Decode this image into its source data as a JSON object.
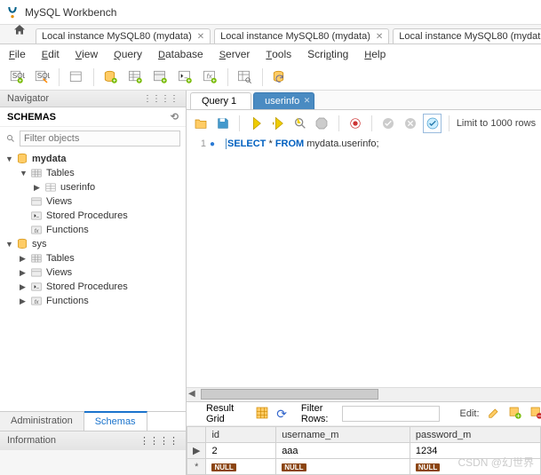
{
  "window": {
    "title": "MySQL Workbench"
  },
  "doc_tabs": [
    {
      "label": "Local instance MySQL80 (mydata)"
    },
    {
      "label": "Local instance MySQL80 (mydata)"
    },
    {
      "label": "Local instance MySQL80 (mydat"
    }
  ],
  "menu": {
    "file": "File",
    "edit": "Edit",
    "view": "View",
    "query": "Query",
    "database": "Database",
    "server": "Server",
    "tools": "Tools",
    "scripting": "Scripting",
    "help": "Help"
  },
  "toolbar_icons": {
    "new_sql": "sql-new-icon",
    "open_sql": "sql-open-icon",
    "new_model": "model-icon",
    "add_schema": "add-schema-icon",
    "add_table": "add-table-icon",
    "add_view": "add-view-icon",
    "add_proc": "add-proc-icon",
    "add_func": "add-func-icon",
    "search": "search-icon",
    "rebuild": "rebuild-icon"
  },
  "navigator": {
    "title": "Navigator",
    "schemas_label": "SCHEMAS",
    "filter_placeholder": "Filter objects"
  },
  "tree": {
    "db1": {
      "name": "mydata",
      "children": {
        "tables": "Tables",
        "userinfo": "userinfo",
        "views": "Views",
        "stored_procedures": "Stored Procedures",
        "functions": "Functions"
      }
    },
    "db2": {
      "name": "sys",
      "children": {
        "tables": "Tables",
        "views": "Views",
        "stored_procedures": "Stored Procedures",
        "functions": "Functions"
      }
    }
  },
  "side_tabs": {
    "admin": "Administration",
    "schemas": "Schemas"
  },
  "information": {
    "title": "Information"
  },
  "editor_tabs": {
    "tab1": "Query 1",
    "tab2": "userinfo"
  },
  "editor_toolbar": {
    "limit_label": "Limit to 1000 rows"
  },
  "sql": {
    "line_number": "1",
    "select": "SELECT",
    "star": "*",
    "from": "FROM",
    "ident": "mydata.userinfo",
    "semi": ";"
  },
  "result_bar": {
    "result_grid": "Result Grid",
    "filter_rows": "Filter Rows:",
    "edit": "Edit:"
  },
  "chart_data": {
    "type": "table",
    "columns": [
      "id",
      "username_m",
      "password_m"
    ],
    "rows": [
      {
        "id": "2",
        "username_m": "aaa",
        "password_m": "1234"
      },
      {
        "id": "NULL",
        "username_m": "NULL",
        "password_m": "NULL"
      }
    ]
  },
  "watermark": "CSDN @幻世界"
}
